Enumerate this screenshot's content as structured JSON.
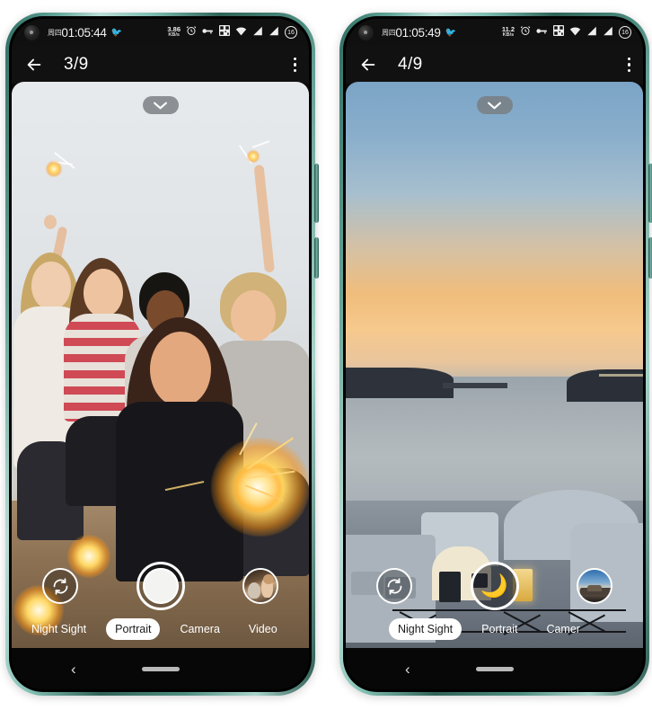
{
  "phones": [
    {
      "id": "left",
      "status": {
        "day": "周四",
        "time": "01:05:44",
        "netspeed_value": "3.86",
        "netspeed_unit": "KB/s",
        "battery": "16"
      },
      "header": {
        "title": "3/9",
        "back_icon": "back-arrow-icon",
        "menu_icon": "overflow-menu-icon"
      },
      "viewfinder": {
        "scene": "group-selfie-sparklers",
        "chevron_icon": "chevron-down-icon"
      },
      "controls": {
        "switch_icon": "switch-camera-icon",
        "shutter_label": "shutter-button",
        "shutter_icon": "",
        "thumbnail_label": "last-photo-thumbnail"
      },
      "modes": [
        {
          "label": "Night Sight",
          "active": false
        },
        {
          "label": "Portrait",
          "active": true
        },
        {
          "label": "Camera",
          "active": false
        },
        {
          "label": "Video",
          "active": false
        }
      ],
      "nav": {
        "back": "‹",
        "home": "home-indicator"
      }
    },
    {
      "id": "right",
      "status": {
        "day": "周四",
        "time": "01:05:49",
        "netspeed_value": "11.2",
        "netspeed_unit": "KB/s",
        "battery": "16"
      },
      "header": {
        "title": "4/9",
        "back_icon": "back-arrow-icon",
        "menu_icon": "overflow-menu-icon"
      },
      "viewfinder": {
        "scene": "santorini-sunset",
        "chevron_icon": "chevron-down-icon"
      },
      "controls": {
        "switch_icon": "switch-camera-icon",
        "shutter_label": "shutter-button",
        "shutter_icon": "🌙",
        "thumbnail_label": "last-photo-thumbnail"
      },
      "modes": [
        {
          "label": "Night Sight",
          "active": true
        },
        {
          "label": "Portrait",
          "active": false
        },
        {
          "label": "Camer",
          "active": false
        }
      ],
      "nav": {
        "back": "‹",
        "home": "home-indicator"
      }
    }
  ],
  "colors": {
    "frame": "#4e8e81",
    "accent_white": "#ffffff",
    "status_bg": "#101010",
    "header_bg": "#111111",
    "nav_bg": "#070707",
    "moon": "#f6e3ae"
  }
}
